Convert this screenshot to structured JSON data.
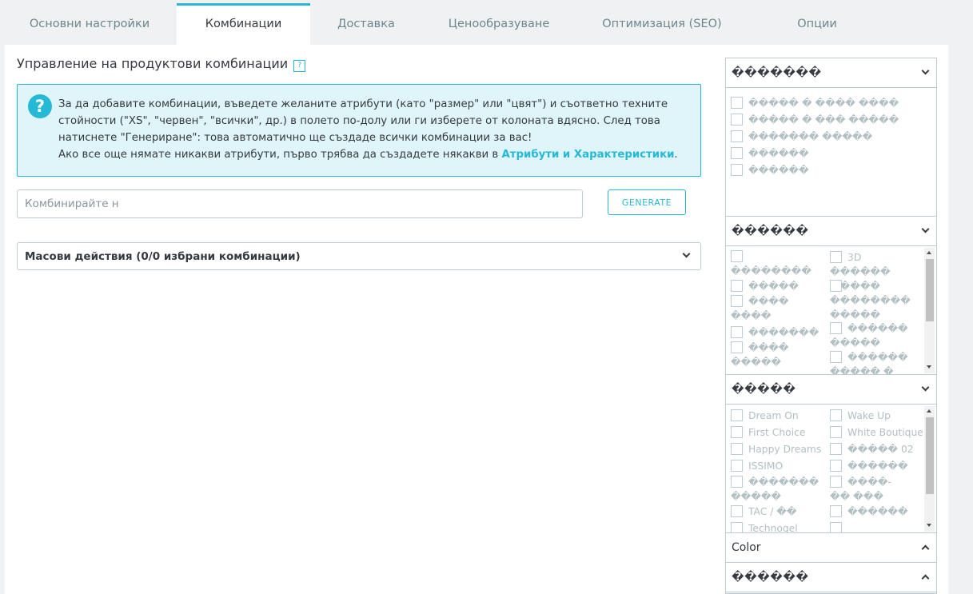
{
  "tabs": {
    "basic": "Основни настройки",
    "combinations": "Комбинации",
    "shipping": "Доставка",
    "pricing": "Ценообразуване",
    "seo": "Оптимизация (SEO)",
    "options": "Опции"
  },
  "page": {
    "title": "Управление на продуктови комбинации",
    "help_mark": "?"
  },
  "info": {
    "icon": "?",
    "line1": "За да добавите комбинации, въведете желаните атрибути (като \"размер\" или \"цвят\") и съответно техните",
    "line2": "стойности (\"XS\", \"червен\", \"всички\", др.) в полето по-долу или ги изберете от колоната вдясно. След това",
    "line3": "натиснете \"Генериране\": това автоматично ще създаде всички комбинации за вас!",
    "line4_prefix": "Ако все още нямате никакви атрибути, първо трябва да създадете някакви в ",
    "link": "Атрибути и Характеристики",
    "line4_suffix": "."
  },
  "search": {
    "placeholder": "Комбинирайте н"
  },
  "generate_button": "GENERATE",
  "bulk_actions": "Масови действия (0/0 избрани комбинации)",
  "attributes": {
    "group1": {
      "title": "�������",
      "options": [
        "����� � ���� ����",
        "����� � ��� �����",
        "������� �����",
        "������",
        "������"
      ]
    },
    "group2": {
      "title": "������",
      "col1": [
        "��������",
        "�����",
        "���� ����",
        "�������",
        "���� �����"
      ],
      "col2": [
        "3D ������ �����",
        "�������� �����",
        "������ �����",
        "������ ����� �"
      ]
    },
    "group3": {
      "title": "�����",
      "col1": [
        "Dream On",
        "First Choice",
        "Happy Dreams",
        "ISSIMO",
        "������� �����",
        "TAC / ��",
        "Technogel"
      ],
      "col2": [
        "Wake Up",
        "White Boutique",
        "����� 02",
        "������",
        "����-�� ���",
        "������",
        ""
      ]
    },
    "group4": {
      "title": "Color"
    },
    "group5": {
      "title": "������"
    }
  }
}
